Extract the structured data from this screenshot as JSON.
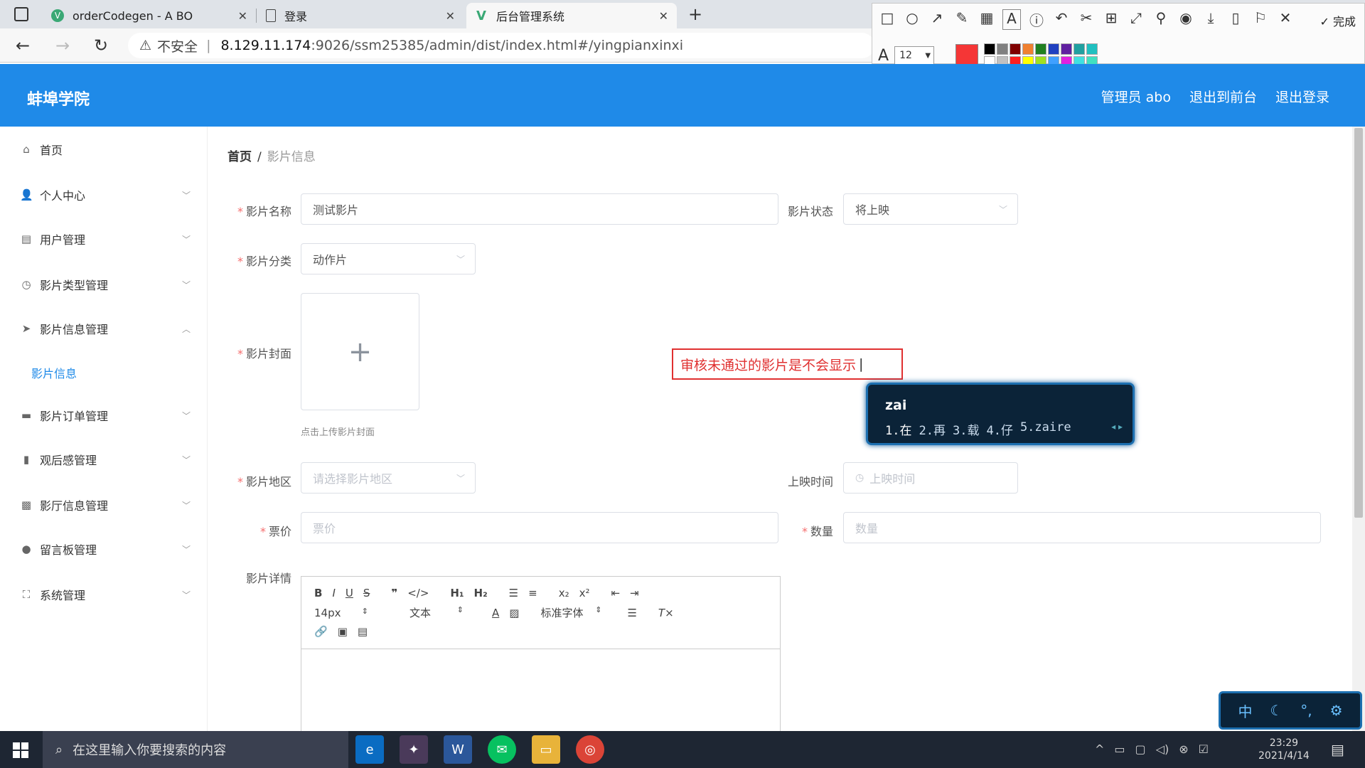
{
  "browser": {
    "tabs": [
      {
        "label": "orderCodegen - A BO",
        "icon": "vue-logo-icon"
      },
      {
        "label": "登录",
        "icon": "document-icon"
      },
      {
        "label": "后台管理系统",
        "icon": "vue-logo-icon"
      }
    ],
    "url_warning": "不安全",
    "url_host": "8.129.11.174",
    "url_path": ":9026/ssm25385/admin/dist/index.html#/yingpianxinxi"
  },
  "annot_toolbar": {
    "font_size": "12",
    "done_label": "完成",
    "current_color": "#f53636",
    "palette": [
      "#000000",
      "#808080",
      "#800000",
      "#f08030",
      "#208020",
      "#2040c0",
      "#6020a0",
      "#20a0a0",
      "#20c0c0",
      "#ffffff",
      "#c0c0c0",
      "#ff2020",
      "#ffff00",
      "#a0e020",
      "#40a0ff",
      "#e020e0",
      "#40e0e0",
      "#40e0c0"
    ]
  },
  "app": {
    "title": "蚌埠学院",
    "admin_label": "管理员 abo",
    "to_front_label": "退出到前台",
    "logout_label": "退出登录"
  },
  "sidebar": {
    "items": [
      {
        "label": "首页",
        "icon": "home-icon"
      },
      {
        "label": "个人中心",
        "icon": "user-icon"
      },
      {
        "label": "用户管理",
        "icon": "chart-icon"
      },
      {
        "label": "影片类型管理",
        "icon": "clock-icon"
      },
      {
        "label": "影片信息管理",
        "icon": "send-icon"
      },
      {
        "label": "影片订单管理",
        "icon": "briefcase-icon"
      },
      {
        "label": "观后感管理",
        "icon": "bar-chart-icon"
      },
      {
        "label": "影厅信息管理",
        "icon": "message-icon"
      },
      {
        "label": "留言板管理",
        "icon": "location-icon"
      },
      {
        "label": "系统管理",
        "icon": "fullscreen-icon"
      }
    ],
    "sub_item": "影片信息"
  },
  "breadcrumb": {
    "home": "首页",
    "sep": "/",
    "current": "影片信息"
  },
  "form": {
    "name_label": "影片名称",
    "name_value": "测试影片",
    "status_label": "影片状态",
    "status_value": "将上映",
    "category_label": "影片分类",
    "category_value": "动作片",
    "cover_label": "影片封面",
    "cover_tip": "点击上传影片封面",
    "region_label": "影片地区",
    "region_placeholder": "请选择影片地区",
    "release_label": "上映时间",
    "release_placeholder": "上映时间",
    "price_label": "票价",
    "price_placeholder": "票价",
    "qty_label": "数量",
    "qty_placeholder": "数量",
    "detail_label": "影片详情"
  },
  "editor": {
    "font_size": "14px",
    "format": "文本",
    "font_family": "标准字体"
  },
  "annotation_text": "审核未通过的影片是不会显示",
  "ime": {
    "composition": "zai",
    "candidates": [
      "1.在",
      "2.再",
      "3.载",
      "4.仔",
      "5.zaire"
    ],
    "bar_mode": "中"
  },
  "taskbar": {
    "search_placeholder": "在这里输入你要搜索的内容",
    "time": "23:29",
    "date": "2021/4/14"
  }
}
